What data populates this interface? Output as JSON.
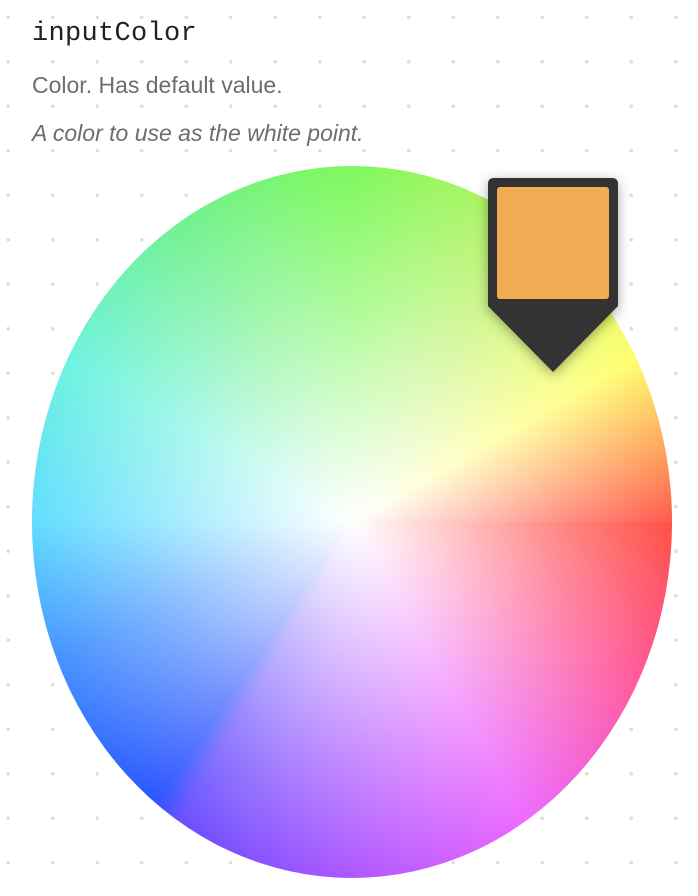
{
  "parameter": {
    "name": "inputColor",
    "type_label": "Color. Has default value.",
    "description": "A color to use as the white point."
  },
  "color_wheel": {
    "selected_color": "#f2ad54",
    "marker_color": "#333333"
  }
}
